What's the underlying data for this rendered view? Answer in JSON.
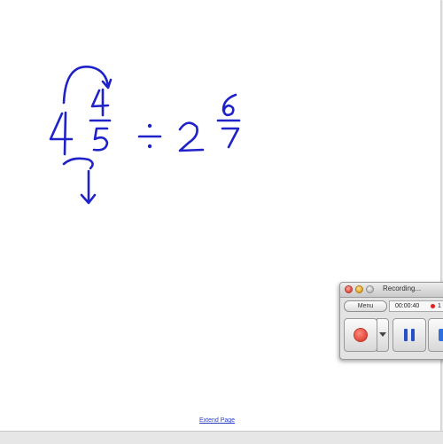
{
  "whiteboard": {
    "extend_page_label": "Extend Page"
  },
  "ink": {
    "color": "#1f22c9",
    "first_mixed_number": {
      "whole": "4",
      "numerator": "4",
      "denominator": "5"
    },
    "operator": "÷",
    "second_mixed_number": {
      "whole": "2",
      "numerator": "6",
      "denominator": "7"
    }
  },
  "recorder": {
    "title": "Recording...",
    "menu_label": "Menu",
    "elapsed_time": "00:00:40",
    "track_count": "1",
    "icons": {
      "close": "close-light-icon",
      "minimize": "minimize-light-icon",
      "zoom": "zoom-light-icon",
      "record": "record-icon",
      "dropdown": "chevron-down-icon",
      "pause": "pause-icon",
      "stop": "stop-icon"
    }
  }
}
